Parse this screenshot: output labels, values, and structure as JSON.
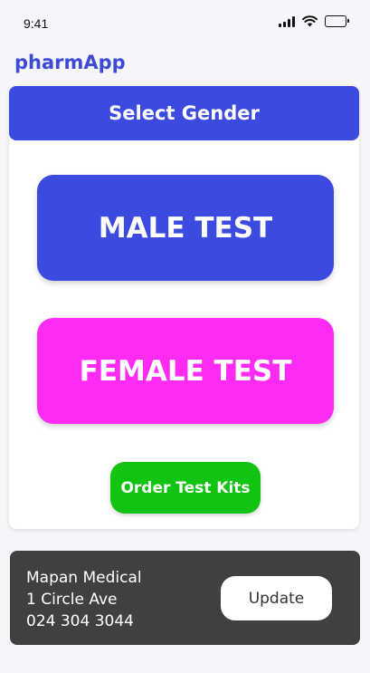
{
  "status_bar": {
    "time": "9:41"
  },
  "app": {
    "title": "pharmApp"
  },
  "gender_card": {
    "header": "Select Gender",
    "male_button": "MALE TEST",
    "female_button": "FEMALE TEST",
    "order_button": "Order Test Kits"
  },
  "footer": {
    "address_lines": [
      "Mapan Medical",
      "1 Circle Ave",
      "024 304 3044"
    ],
    "update_button": "Update"
  },
  "colors": {
    "brand_blue": "#3b4be0",
    "female_pink": "#ff2bf2",
    "order_green": "#11c411",
    "footer_bg": "#404040"
  },
  "icons": [
    "signal-icon",
    "wifi-icon",
    "battery-icon"
  ]
}
